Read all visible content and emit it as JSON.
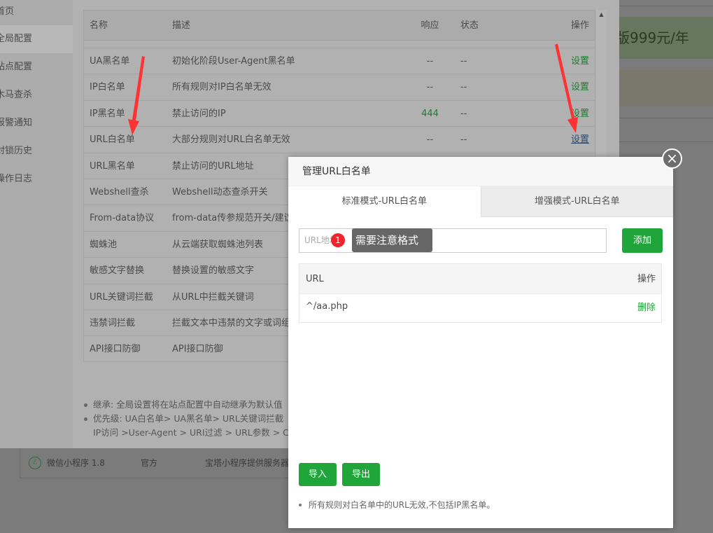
{
  "background": {
    "promo_text": "版999元/年",
    "plugin": {
      "name": "微信小程序 1.8",
      "author": "官方",
      "desc": "宝塔小程序提供服务器"
    }
  },
  "sidebar": {
    "items": [
      {
        "label": "首页"
      },
      {
        "label": "全局配置",
        "active": true
      },
      {
        "label": "站点配置"
      },
      {
        "label": "木马查杀"
      },
      {
        "label": "报警通知"
      },
      {
        "label": "封锁历史"
      },
      {
        "label": "操作日志"
      }
    ]
  },
  "table": {
    "headers": {
      "name": "名称",
      "desc": "描述",
      "resp": "响应",
      "status": "状态",
      "action": "操作"
    },
    "rows": [
      {
        "name": "UA黑名单",
        "desc": "初始化阶段User-Agent黑名单",
        "resp": "--",
        "status": "--",
        "action": "设置"
      },
      {
        "name": "IP白名单",
        "desc": "所有规则对IP白名单无效",
        "resp": "--",
        "status": "--",
        "action": "设置"
      },
      {
        "name": "IP黑名单",
        "desc": "禁止访问的IP",
        "resp": "444",
        "status": "--",
        "action": "设置"
      },
      {
        "name": "URL白名单",
        "desc": "大部分规则对URL白名单无效",
        "resp": "--",
        "status": "--",
        "action": "设置"
      },
      {
        "name": "URL黑名单",
        "desc": "禁止访问的URL地址"
      },
      {
        "name": "Webshell查杀",
        "desc": "Webshell动态查杀开关"
      },
      {
        "name": "From-data协议",
        "desc": "from-data传参规范开关/建议"
      },
      {
        "name": "蜘蛛池",
        "desc": "从云端获取蜘蛛池列表"
      },
      {
        "name": "敏感文字替换",
        "desc": "替换设置的敏感文字"
      },
      {
        "name": "URL关键词拦截",
        "desc": "从URL中拦截关键词"
      },
      {
        "name": "违禁词拦截",
        "desc": "拦截文本中违禁的文字或词组"
      },
      {
        "name": "API接口防御",
        "desc": "API接口防御"
      }
    ]
  },
  "notes": [
    "继承: 全局设置将在站点配置中自动继承为默认值",
    "优先级: UA白名单> UA黑名单> URL关键词拦截",
    "IP访问 >User-Agent > URI过滤 > URL参数 > C"
  ],
  "modal": {
    "title": "管理URL白名单",
    "tabs": [
      {
        "label": "标准模式-URL白名单",
        "active": true
      },
      {
        "label": "增强模式-URL白名单"
      }
    ],
    "input_placeholder": "URL地址",
    "badge": "1",
    "tooltip": "需要注意格式",
    "add_label": "添加",
    "table": {
      "headers": {
        "url": "URL",
        "action": "操作"
      },
      "rows": [
        {
          "url": "^/aa.php",
          "action": "删除"
        }
      ]
    },
    "import_label": "导入",
    "export_label": "导出",
    "note": "所有规则对白名单中的URL无效,不包括IP黑名单。",
    "close": "×"
  },
  "colors": {
    "accent": "#20a53a",
    "badge": "#f0242c",
    "arrow": "#ff3333"
  }
}
